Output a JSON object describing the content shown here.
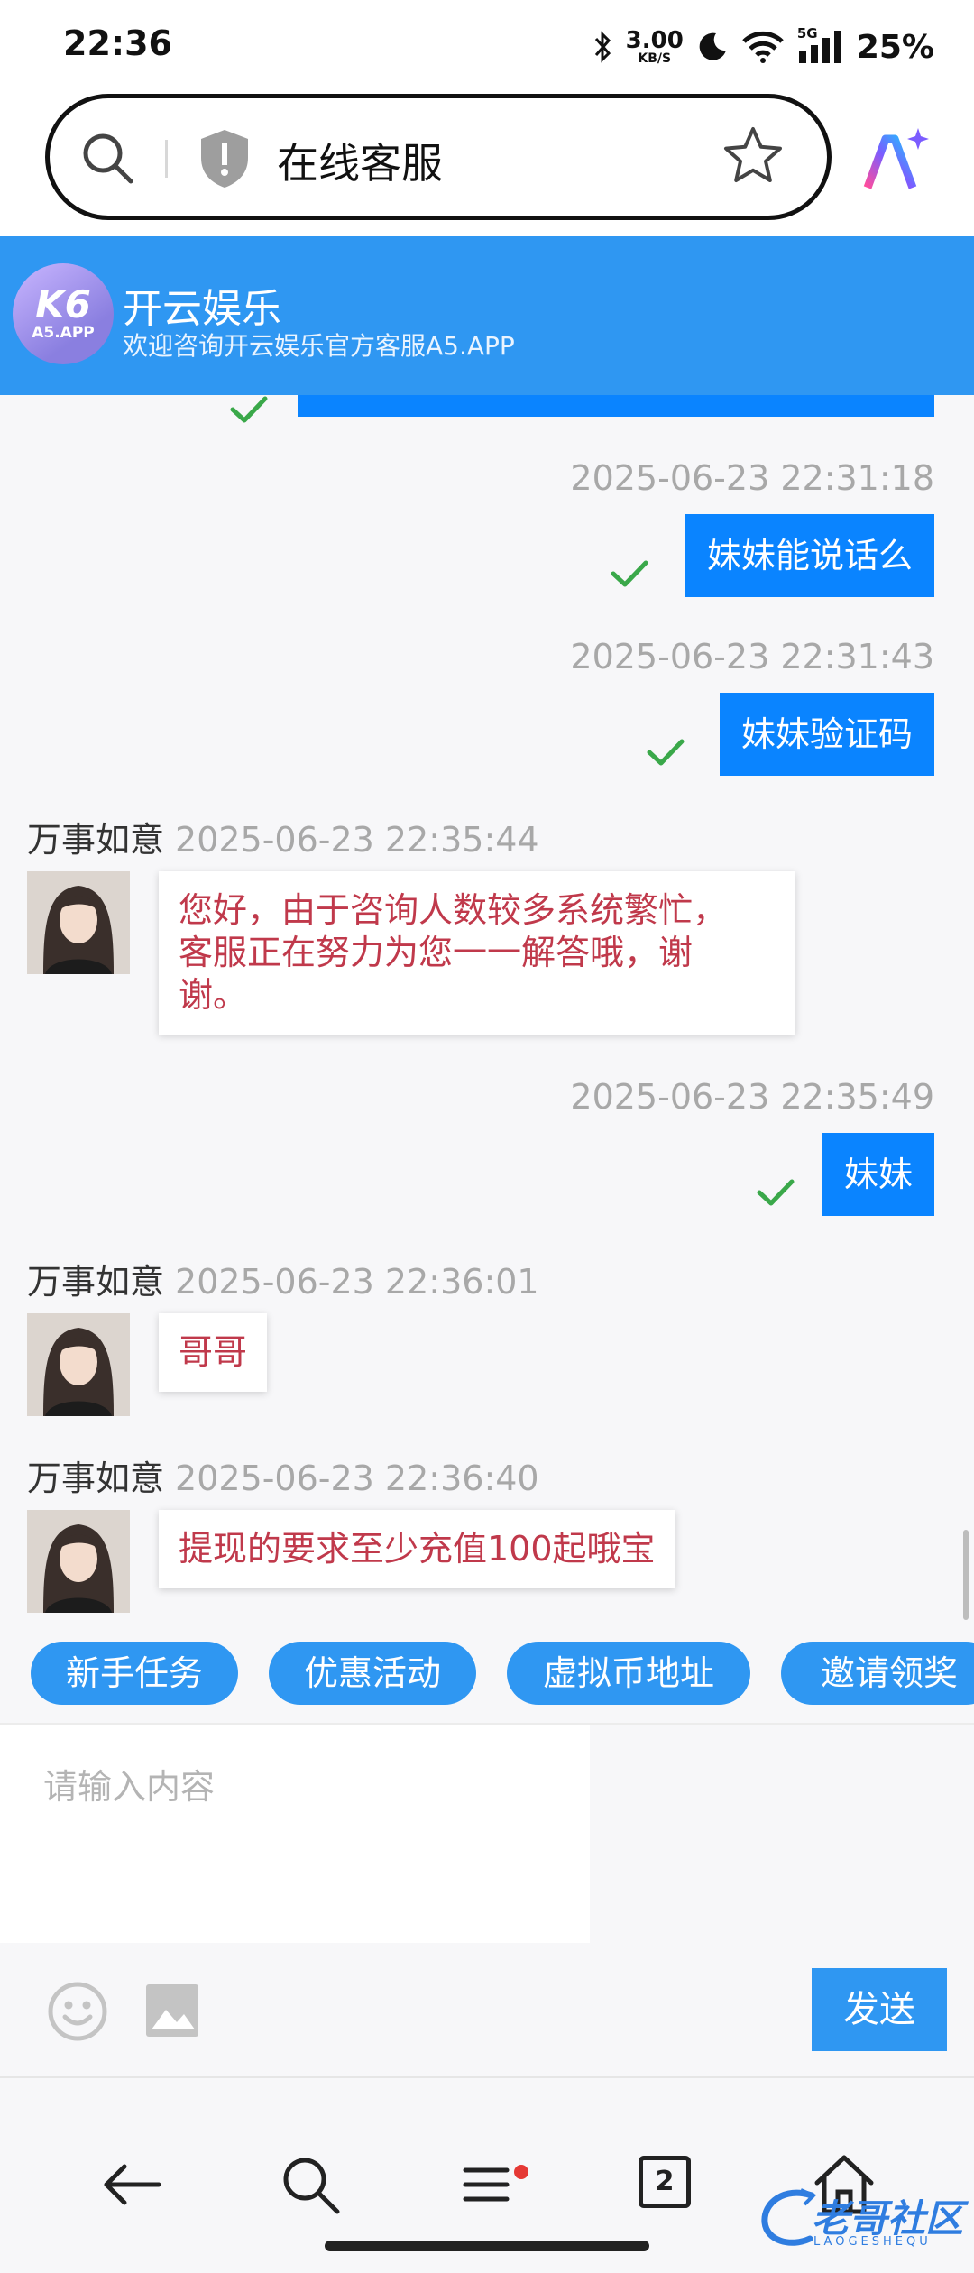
{
  "status_bar": {
    "time": "22:36",
    "net_speed_value": "3.00",
    "net_speed_unit": "KB/S",
    "network": "5G",
    "battery": "25%"
  },
  "address_bar": {
    "title": "在线客服"
  },
  "app_header": {
    "logo_text": "K6",
    "logo_sub": "A5.APP",
    "name": "开云娱乐",
    "subtitle": "欢迎咨询开云娱乐官方客服A5.APP"
  },
  "messages": [
    {
      "direction": "out",
      "timestamp": "2025-06-23 22:31:18",
      "text": "妹妹能说话么"
    },
    {
      "direction": "out",
      "timestamp": "2025-06-23 22:31:43",
      "text": "妹妹验证码"
    },
    {
      "direction": "in",
      "sender": "万事如意",
      "timestamp": "2025-06-23 22:35:44",
      "lines": [
        "您好，由于咨询人数较多系统繁忙，",
        "客服正在努力为您一一解答哦，谢",
        "谢。"
      ]
    },
    {
      "direction": "out",
      "timestamp": "2025-06-23 22:35:49",
      "text": "妹妹"
    },
    {
      "direction": "in",
      "sender": "万事如意",
      "timestamp": "2025-06-23 22:36:01",
      "text": "哥哥"
    },
    {
      "direction": "in",
      "sender": "万事如意",
      "timestamp": "2025-06-23 22:36:40",
      "text": "提现的要求至少充值100起哦宝"
    }
  ],
  "quick_actions": [
    "新手任务",
    "优惠活动",
    "虚拟币地址",
    "邀请领奖"
  ],
  "composer": {
    "placeholder": "请输入内容",
    "send_label": "发送"
  },
  "bottom_nav": {
    "tab_count": "2"
  },
  "watermark": {
    "text": "老哥社区",
    "sub": "LAOGESHEQU"
  },
  "colors": {
    "header_blue": "#2f97f2",
    "outgoing_bubble": "#0a84ff",
    "incoming_text": "#c0394b",
    "check_green": "#3aa84a"
  }
}
